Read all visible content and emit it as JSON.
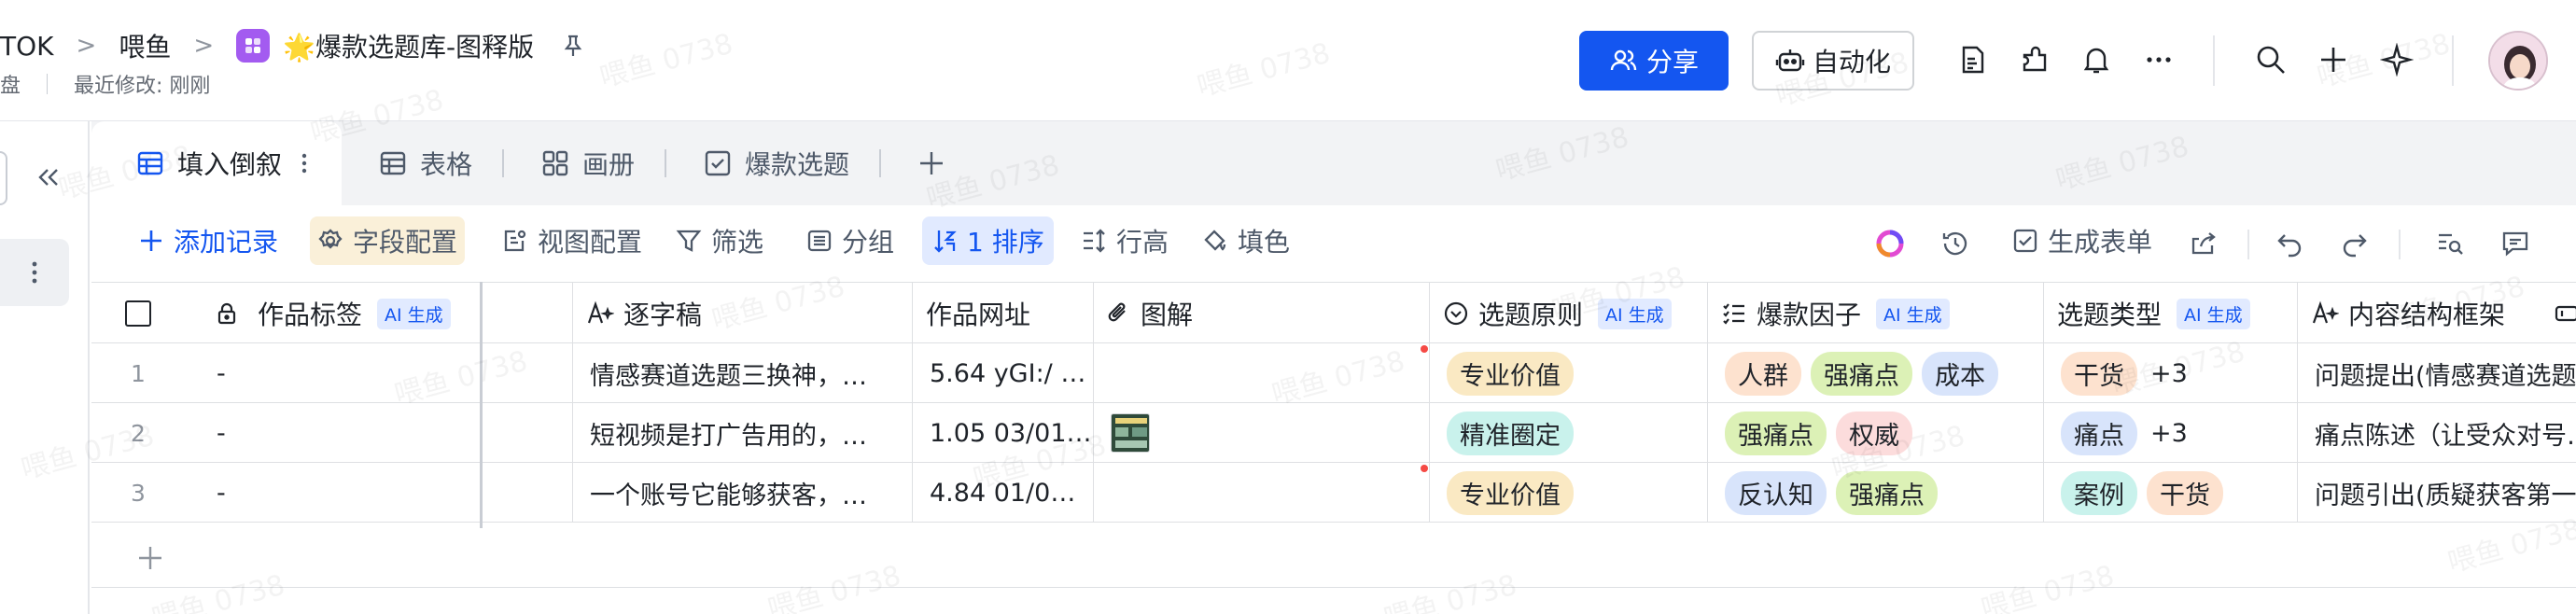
{
  "breadcrumb": {
    "items": [
      "TOK",
      "喂鱼"
    ],
    "doc_title": "🌟爆款选题库-图释版"
  },
  "meta": {
    "location": "盘",
    "last_modified": "最近修改: 刚刚"
  },
  "header": {
    "share_label": "分享",
    "automation_label": "自动化"
  },
  "tabs": [
    {
      "label": "填入倒叙",
      "icon": "grid-table-icon",
      "active": true
    },
    {
      "label": "表格",
      "icon": "table-icon",
      "active": false
    },
    {
      "label": "画册",
      "icon": "gallery-icon",
      "active": false
    },
    {
      "label": "爆款选题",
      "icon": "form-check-icon",
      "active": false
    }
  ],
  "toolbar": {
    "add_record": "添加记录",
    "field_config": "字段配置",
    "view_config": "视图配置",
    "filter": "筛选",
    "group": "分组",
    "sort": "1 排序",
    "row_height": "行高",
    "fill_color": "填色",
    "generate_form": "生成表单"
  },
  "grid": {
    "ai_badge": "AI 生成",
    "columns": [
      {
        "key": "tags",
        "label": "作品标签",
        "icon": "lock-icon",
        "ai": true
      },
      {
        "key": "transcript",
        "label": "逐字稿",
        "icon": "ai-text-icon",
        "ai": false
      },
      {
        "key": "url",
        "label": "作品网址",
        "icon": null,
        "ai": false
      },
      {
        "key": "image",
        "label": "图解",
        "icon": "attachment-icon",
        "ai": false
      },
      {
        "key": "principle",
        "label": "选题原则",
        "icon": "single-select-icon",
        "ai": true
      },
      {
        "key": "factor",
        "label": "爆款因子",
        "icon": "multi-select-icon",
        "ai": true
      },
      {
        "key": "type",
        "label": "选题类型",
        "icon": null,
        "ai": true
      },
      {
        "key": "structure",
        "label": "内容结构框架",
        "icon": "ai-text-icon",
        "ai": false
      }
    ],
    "rows": [
      {
        "num": "1",
        "tags": "-",
        "transcript": "情感赛道选题三换神，…",
        "url": "5.64 yGI:/ …",
        "has_image": false,
        "principle": {
          "text": "专业价值",
          "color": "yellow"
        },
        "factors": [
          {
            "text": "人群",
            "color": "orange"
          },
          {
            "text": "强痛点",
            "color": "green"
          },
          {
            "text": "成本",
            "color": "blue"
          }
        ],
        "types": [
          {
            "text": "干货",
            "color": "orange"
          }
        ],
        "types_more": "+3",
        "structure": "问题提出(情感赛道选题…"
      },
      {
        "num": "2",
        "tags": "-",
        "transcript": "短视频是打广告用的，…",
        "url": "1.05 03/01…",
        "has_image": true,
        "principle": {
          "text": "精准圈定",
          "color": "cyan"
        },
        "factors": [
          {
            "text": "强痛点",
            "color": "green"
          },
          {
            "text": "权威",
            "color": "pink"
          }
        ],
        "types": [
          {
            "text": "痛点",
            "color": "blue"
          }
        ],
        "types_more": "+3",
        "structure": "痛点陈述（让受众对号…"
      },
      {
        "num": "3",
        "tags": "-",
        "transcript": "一个账号它能够获客，…",
        "url": "4.84 01/0…",
        "has_image": false,
        "principle": {
          "text": "专业价值",
          "color": "yellow"
        },
        "factors": [
          {
            "text": "反认知",
            "color": "blue"
          },
          {
            "text": "强痛点",
            "color": "green"
          }
        ],
        "types": [
          {
            "text": "案例",
            "color": "cyan"
          },
          {
            "text": "干货",
            "color": "orange"
          }
        ],
        "types_more": "",
        "structure": "问题引出(质疑获客第一…"
      }
    ]
  },
  "watermark": "喂鱼 0738",
  "colors": {
    "primary": "#1456f0",
    "ai_badge_bg": "#e1eaff",
    "tag_yellow": "#fae9c3",
    "tag_cyan": "#c9f2ec",
    "tag_orange": "#fde2cf",
    "tag_green": "#dcf1b6",
    "tag_blue": "#d8e4fb",
    "tag_pink": "#fcdcdc"
  }
}
